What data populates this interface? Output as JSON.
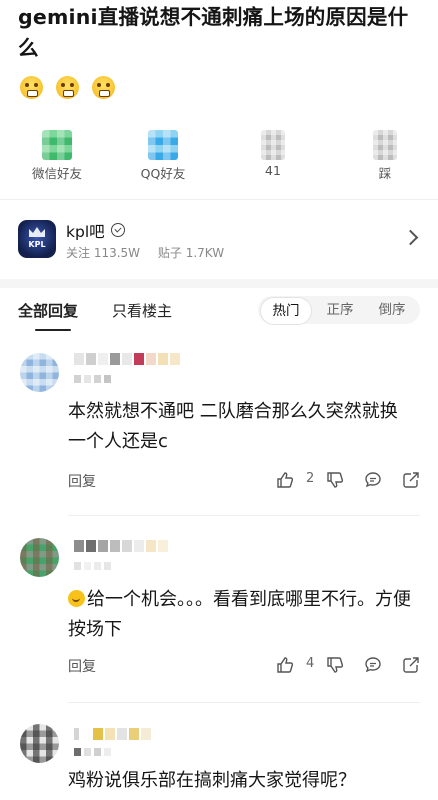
{
  "post": {
    "title": "gemini直播说想不通刺痛上场的原因是什么",
    "emojis": [
      "face-emoji",
      "face-emoji",
      "face-emoji"
    ]
  },
  "share": [
    {
      "label": "微信好友",
      "icon": "wechat-icon"
    },
    {
      "label": "QQ好友",
      "icon": "qq-icon"
    },
    {
      "label": "41",
      "icon": "like-icon"
    },
    {
      "label": "踩",
      "icon": "dislike-icon"
    }
  ],
  "forum": {
    "name": "kpl吧",
    "logo_text": "KPL",
    "followers_label": "关注 113.5W",
    "posts_label": "贴子 1.7KW"
  },
  "tabs": {
    "all": "全部回复",
    "host_only": "只看楼主",
    "sort_hot": "热门",
    "sort_asc": "正序",
    "sort_desc": "倒序",
    "active_sort": "热门"
  },
  "comments": [
    {
      "text": "本然就想不通吧 二队磨合那么久突然就换一个人还是c",
      "reply_label": "回复",
      "like_count": "2",
      "has_emoji": false
    },
    {
      "text": "给一个机会。。。看看到底哪里不行。方便按场下",
      "reply_label": "回复",
      "like_count": "4",
      "has_emoji": true
    },
    {
      "text": "鸡粉说俱乐部在搞刺痛大家觉得呢？",
      "reply_label": "",
      "like_count": "",
      "has_emoji": false
    }
  ],
  "colors": {
    "text_primary": "#161616",
    "text_secondary": "#888888",
    "divider": "#eeeeee",
    "sort_bg": "#f4f4f4"
  }
}
